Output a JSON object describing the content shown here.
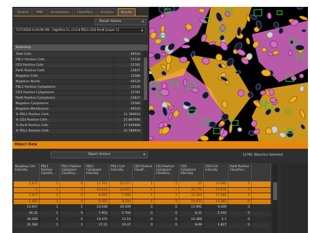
{
  "tabs": [
    {
      "label": "Studies"
    },
    {
      "label": "PMA"
    },
    {
      "label": "Annotations"
    },
    {
      "label": "Classifiers"
    },
    {
      "label": "Analysis"
    },
    {
      "label": "Results"
    }
  ],
  "active_tab": "Results",
  "result_actions": {
    "label": "Result Actions"
  },
  "file_select": {
    "value": "7/27/2020 9:20:09 AM - HighPlex FL v3.0.8 PDL1 CD3 PanK [Layer 1]"
  },
  "summary": {
    "title": "Summary",
    "rows": [
      {
        "key": "Total Cells",
        "value": "49524"
      },
      {
        "key": "PDL1 Positive Cells",
        "value": "15530"
      },
      {
        "key": "CD3 Positive Cells",
        "value": "12781"
      },
      {
        "key": "PanK Positive Cells",
        "value": "13837"
      },
      {
        "key": "Negative Cells",
        "value": "15580"
      },
      {
        "key": "Negative Nuclei",
        "value": "49524"
      },
      {
        "key": "PDL1 Positive Cytoplasms",
        "value": "15530"
      },
      {
        "key": "CD3 Positive Cytoplasms",
        "value": "12781"
      },
      {
        "key": "PanK Positive Cytoplasms",
        "value": "13837"
      },
      {
        "key": "Negative Cytoplasms",
        "value": "15580"
      },
      {
        "key": "Negative Membranes",
        "value": "49524"
      },
      {
        "key": "% PDL1 Positive Cells",
        "value": "31.780919"
      },
      {
        "key": "% CD3 Positive Cells",
        "value": "25.807690"
      },
      {
        "key": "% PanK Positive Cells",
        "value": "27.939989"
      },
      {
        "key": "% PDL1 Positive Cells",
        "value": "31.780919"
      }
    ]
  },
  "object_data": {
    "title": "Object Data",
    "actions_label": "Object Actions",
    "selected_text": "12781 Object(s) Selected",
    "columns": [
      "Nonplexy Cell Intensity",
      "PDL1 Positive Classific...",
      "PDL1 Positive Cytoplasm Classifica...",
      "PDL1 Cytoplasm Intensity",
      "PDL1 Cell Intensity",
      "CD3 Positive Classif...",
      "CD3 Positive Cytoplasm Classifica...",
      "CD3 Cytoplasm Intensity",
      "CD3 Cell Intensity",
      "PanK Positive Classifica...",
      ""
    ],
    "rows": [
      {
        "selected": true,
        "cells": [
          "1,871",
          "1",
          "0",
          "11.761",
          "10.277",
          "1",
          "1",
          "27",
          "14.982",
          "0",
          ""
        ]
      },
      {
        "selected": true,
        "cells": [
          "1",
          "1",
          "0",
          "10.032",
          "14.615",
          "1",
          "1",
          "21.776",
          "17.672",
          "0",
          ""
        ]
      },
      {
        "selected": true,
        "cells": [
          "1.617",
          "1",
          "0",
          "8.061",
          "7.206",
          "1",
          "1",
          "22.303",
          "17.261",
          "0",
          ""
        ]
      },
      {
        "selected": true,
        "cells": [
          "1.402",
          "1",
          "0",
          "9.355",
          "8.224",
          "1",
          "1",
          "19.033",
          "15.387",
          "0",
          ""
        ]
      },
      {
        "selected": false,
        "cells": [
          "15.647",
          "1",
          "1",
          "23.638",
          "20.209",
          "0",
          "0",
          "12.991",
          "9.449",
          "0",
          ""
        ]
      },
      {
        "selected": false,
        "cells": [
          "26.32",
          "1",
          "0",
          "7.952",
          "5.793",
          "0",
          "0",
          "8.31",
          "5.192",
          "0",
          ""
        ]
      },
      {
        "selected": false,
        "cells": [
          "30.428",
          "1",
          "0",
          "19.475",
          "11.16",
          "0",
          "0",
          "10.368",
          "4.7",
          "0",
          ""
        ]
      },
      {
        "selected": false,
        "cells": [
          "31.184",
          "1",
          "1",
          "27.21",
          "19.37",
          "0",
          "0",
          "8.09",
          "1.827",
          "0",
          ""
        ]
      }
    ]
  },
  "colors": {
    "accent": "#e8870e",
    "panel": "#2b2b2b",
    "cell_magenta": "#d86ac4",
    "cell_yellow": "#f0b020",
    "cell_blue_outline": "#5a6fd0",
    "cell_green_box": "#35c040"
  },
  "icons": {
    "dropdown": "chevron-down-icon"
  }
}
